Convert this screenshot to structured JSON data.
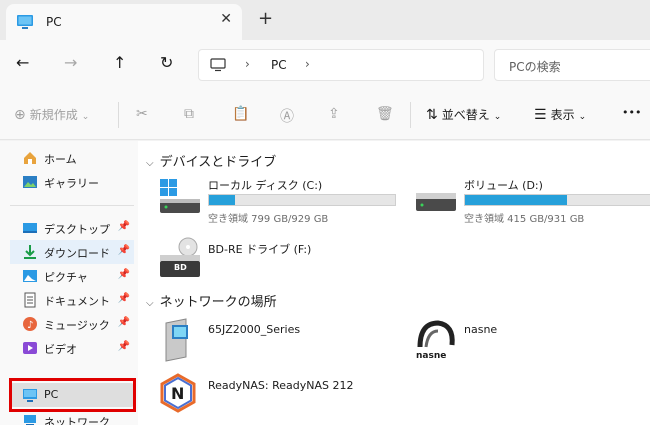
{
  "tab": {
    "title": "PC",
    "close": "✕",
    "new_tab": "+"
  },
  "nav": {
    "back": "←",
    "forward": "→",
    "up": "↑",
    "refresh": "↻"
  },
  "address": {
    "separator": "›",
    "crumb": "PC"
  },
  "search": {
    "placeholder": "PCの検索"
  },
  "toolbar": {
    "new_label": "新規作成",
    "sort_label": "並べ替え",
    "view_label": "表示",
    "more": "•••"
  },
  "sidebar": {
    "items": [
      {
        "label": "ホーム",
        "icon": "home-icon"
      },
      {
        "label": "ギャラリー",
        "icon": "gallery-icon"
      },
      {
        "label": "デスクトップ",
        "icon": "desktop-icon",
        "pinned": true
      },
      {
        "label": "ダウンロード",
        "icon": "download-icon",
        "pinned": true
      },
      {
        "label": "ピクチャ",
        "icon": "pictures-icon",
        "pinned": true
      },
      {
        "label": "ドキュメント",
        "icon": "documents-icon",
        "pinned": true
      },
      {
        "label": "ミュージック",
        "icon": "music-icon",
        "pinned": true
      },
      {
        "label": "ビデオ",
        "icon": "videos-icon",
        "pinned": true
      },
      {
        "label": "PC",
        "icon": "pc-icon",
        "selected": true
      },
      {
        "label": "ネットワーク",
        "icon": "network-icon"
      }
    ]
  },
  "content": {
    "devices_header": "デバイスとドライブ",
    "drives": [
      {
        "name": "ローカル ディスク (C:)",
        "info": "空き領域 799 GB/929 GB",
        "used_fraction": 0.14
      },
      {
        "name": "ボリューム (D:)",
        "info": "空き領域 415 GB/931 GB",
        "used_fraction": 0.55
      }
    ],
    "optical": {
      "name": "BD-RE ドライブ (F:)",
      "badge": "BD"
    },
    "network_header": "ネットワークの場所",
    "network_devices": [
      {
        "name": "65JZ2000_Series"
      },
      {
        "name": "nasne",
        "logo_text": "nasne"
      },
      {
        "name": "ReadyNAS: ReadyNAS 212",
        "logo_text": "N"
      }
    ]
  },
  "colors": {
    "accent": "#26a0da",
    "highlight": "#e00000"
  }
}
